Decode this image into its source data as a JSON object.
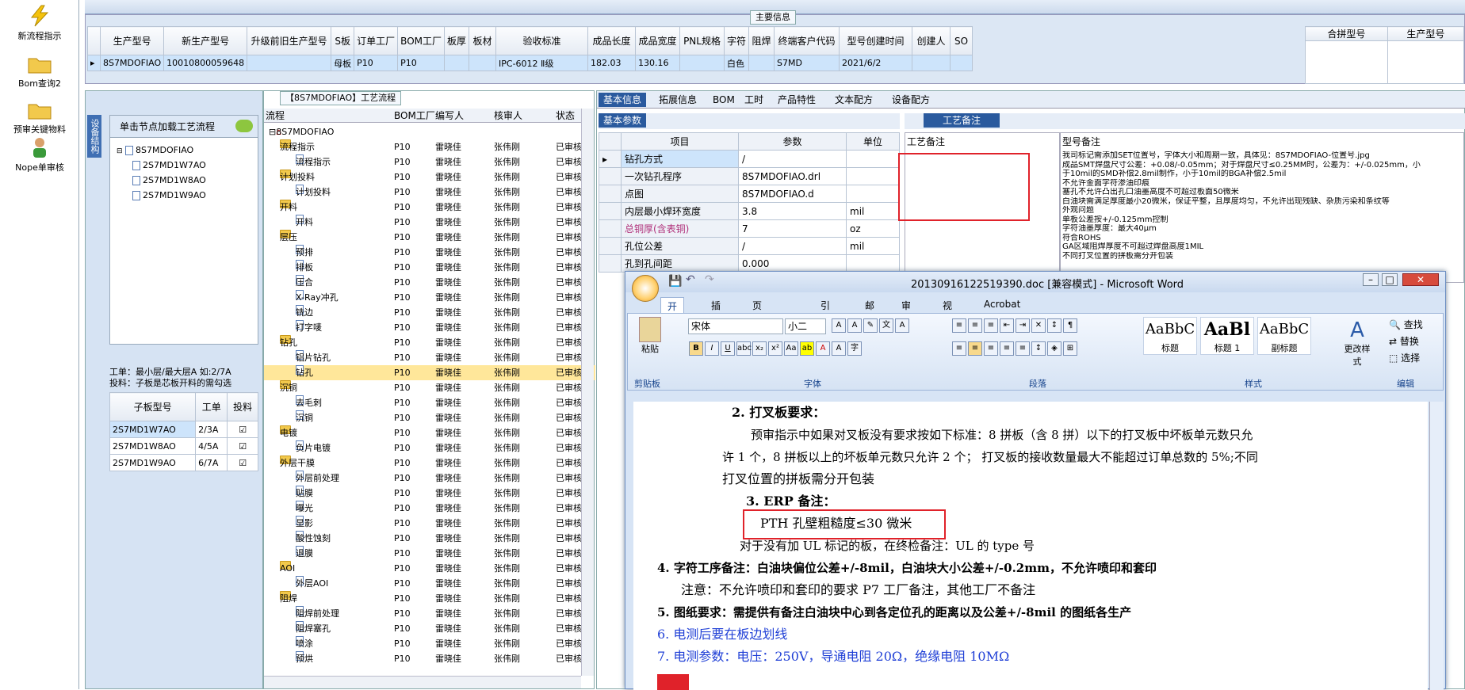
{
  "nav": [
    {
      "label": "新流程指示",
      "icon": "lightning-icon"
    },
    {
      "label": "Bom查询2",
      "icon": "folder-icon"
    },
    {
      "label": "预审关键物料",
      "icon": "folder-icon"
    },
    {
      "label": "Nope单审核",
      "icon": "user-icon"
    }
  ],
  "main_info": {
    "title": "主要信息",
    "headers": [
      "生产型号",
      "新生产型号",
      "升级前旧生产型号",
      "S板",
      "订单工厂",
      "BOM工厂",
      "板厚",
      "板材",
      "验收标准",
      "成品长度",
      "成品宽度",
      "PNL规格",
      "字符",
      "阻焊",
      "终端客户代码",
      "型号创建时间",
      "创建人",
      "SO"
    ],
    "row": [
      "8S7MDOFIAO",
      "10010800059648",
      "",
      "母板",
      "P10",
      "P10",
      "",
      "",
      "IPC-6012 Ⅱ级",
      "182.03",
      "130.16",
      "",
      "白色",
      "",
      "S7MD",
      "2021/6/2",
      "",
      ""
    ],
    "merge_headers": [
      "合拼型号",
      "生产型号"
    ]
  },
  "left": {
    "side_tab": "设备结构",
    "load_btn": "单击节点加载工艺流程",
    "tree_root": "8S7MDOFIAO",
    "tree_children": [
      "2S7MD1W7AO",
      "2S7MD1W8AO",
      "2S7MD1W9AO"
    ],
    "note1": "工单：最小层/最大层A 如:2/7A",
    "note2": "投料：子板是芯板开料的需勾选",
    "sub_headers": [
      "子板型号",
      "工单",
      "投料"
    ],
    "sub_rows": [
      [
        "2S7MD1W7AO",
        "2/3A"
      ],
      [
        "2S7MD1W8AO",
        "4/5A"
      ],
      [
        "2S7MD1W9AO",
        "6/7A"
      ]
    ]
  },
  "flow": {
    "title": "【8S7MDOFIAO】工艺流程",
    "headers": [
      "流程",
      "BOM工厂",
      "编写人",
      "核审人",
      "状态"
    ],
    "root": "8S7MDOFIAO",
    "rows": [
      {
        "name": "流程指示",
        "level": 1,
        "folder": true
      },
      {
        "name": "流程指示",
        "level": 2
      },
      {
        "name": "计划投料",
        "level": 1,
        "folder": true
      },
      {
        "name": "计划投料",
        "level": 2
      },
      {
        "name": "开料",
        "level": 1,
        "folder": true
      },
      {
        "name": "开料",
        "level": 2
      },
      {
        "name": "层压",
        "level": 1,
        "folder": true
      },
      {
        "name": "预排",
        "level": 2
      },
      {
        "name": "排板",
        "level": 2
      },
      {
        "name": "压合",
        "level": 2
      },
      {
        "name": "X-Ray冲孔",
        "level": 2
      },
      {
        "name": "铣边",
        "level": 2
      },
      {
        "name": "打字唛",
        "level": 2
      },
      {
        "name": "钻孔",
        "level": 1,
        "folder": true
      },
      {
        "name": "铝片钻孔",
        "level": 2
      },
      {
        "name": "钻孔",
        "level": 2,
        "hl": true
      },
      {
        "name": "沉铜",
        "level": 1,
        "folder": true
      },
      {
        "name": "去毛刺",
        "level": 2
      },
      {
        "name": "沉铜",
        "level": 2
      },
      {
        "name": "电镀",
        "level": 1,
        "folder": true
      },
      {
        "name": "负片电镀",
        "level": 2
      },
      {
        "name": "外层干膜",
        "level": 1,
        "folder": true
      },
      {
        "name": "外层前处理",
        "level": 2
      },
      {
        "name": "贴膜",
        "level": 2
      },
      {
        "name": "曝光",
        "level": 2
      },
      {
        "name": "显影",
        "level": 2
      },
      {
        "name": "酸性蚀刻",
        "level": 2
      },
      {
        "name": "退膜",
        "level": 2
      },
      {
        "name": "AOI",
        "level": 1,
        "folder": true
      },
      {
        "name": "外层AOI",
        "level": 2
      },
      {
        "name": "阻焊",
        "level": 1,
        "folder": true
      },
      {
        "name": "阻焊前处理",
        "level": 2
      },
      {
        "name": "阻焊塞孔",
        "level": 2
      },
      {
        "name": "喷涂",
        "level": 2
      },
      {
        "name": "预烘",
        "level": 2
      }
    ],
    "bom": "P10",
    "writer": "雷晓佳",
    "reviewer": "张伟刚",
    "status": "已审核"
  },
  "right": {
    "tabs": [
      "基本信息",
      "拓展信息",
      "BOM",
      "工时",
      "产品特性",
      "文本配方",
      "设备配方"
    ],
    "basic_tab": "基本参数",
    "craft_tab": "工艺备注",
    "param_headers": [
      "项目",
      "参数",
      "单位"
    ],
    "params": [
      [
        "钻孔方式",
        "/",
        ""
      ],
      [
        "一次钻孔程序",
        "8S7MDOFIAO.drl",
        ""
      ],
      [
        "点图",
        "8S7MDOFIAO.d",
        ""
      ],
      [
        "内层最小焊环宽度",
        "3.8",
        "mil"
      ],
      [
        "总铜厚(含表铜)",
        "7",
        "oz"
      ],
      [
        "孔位公差",
        "/",
        "mil"
      ],
      [
        "孔到孔间距",
        "0.000",
        ""
      ]
    ],
    "craft_col": "工艺备注",
    "model_col": "型号备注",
    "model_notes": [
      "我司标记需添加SET位置号，字体大小和周期一致，具体见：8S7MDOFIAO-位置号.jpg",
      "成品SMT焊盘尺寸公差：+0.08/-0.05mm；对于焊盘尺寸≤0.25MM时，公差为：+/-0.025mm，小",
      "于10mil的SMD补偿2.8mil制作，小于10mil的BGA补偿2.5mil",
      "不允许金面字符渗油印痕",
      "塞孔不允许凸出孔口油墨高度不可超过板面50微米",
      "白油块需满足厚度最小20微米，保证平整，且厚度均匀，不允许出现残缺、杂质污染和条纹等",
      "外观问题",
      "单板公差按+/-0.125mm控制",
      "字符油墨厚度：最大40μm",
      "符合ROHS",
      "GA区域阻焊厚度不可超过焊盘高度1MIL",
      "不同打叉位置的拼板需分开包装"
    ]
  },
  "word": {
    "title": "20130916122519390.doc [兼容模式] - Microsoft Word",
    "tabs": [
      "开始",
      "插入",
      "页面布局",
      "引用",
      "邮件",
      "审阅",
      "视图",
      "Acrobat"
    ],
    "font": "宋体",
    "size": "小二",
    "groups": [
      "剪贴板",
      "字体",
      "段落",
      "样式",
      "编辑"
    ],
    "paste": "粘贴",
    "styles": [
      {
        "sample": "AaBbC",
        "name": "标题"
      },
      {
        "sample": "AaBl",
        "name": "标题 1"
      },
      {
        "sample": "AaBbC",
        "name": "副标题"
      }
    ],
    "change_style": "更改样式",
    "find": "查找",
    "replace": "替换",
    "select": "选择",
    "lines": [
      "2. 打叉板要求：",
      "预审指示中如果对叉板没有要求按如下标准：8 拼板（含 8 拼）以下的打叉板中坏板单元数只允",
      "许 1 个，8 拼板以上的坏板单元数只允许 2 个；  打叉板的接收数量最大不能超过订单总数的 5%;不同",
      "打叉位置的拼板需分开包装",
      "3. ERP 备注：",
      "PTH 孔壁粗糙度≤30 微米",
      "对于没有加 UL 标记的板，在终检备注：UL 的 type 号",
      "4. 字符工序备注：白油块偏位公差+/-8mil，白油块大小公差+/-0.2mm，不允许喷印和套印",
      "注意：不允许喷印和套印的要求 P7 工厂备注，其他工厂不备注",
      "5.   图纸要求：需提供有备注白油块中心到各定位孔的距离以及公差+/-8mil 的图纸各生产",
      "6.   电测后要在板边划线",
      "7.   电测参数：电压：250V，导通电阻 20Ω，绝缘电阻 10MΩ"
    ]
  },
  "colors": {
    "accent": "#2a5a9e",
    "highlight": "#ffe79a",
    "red_box": "#e0222a",
    "link_blue": "#1f3fd6"
  }
}
